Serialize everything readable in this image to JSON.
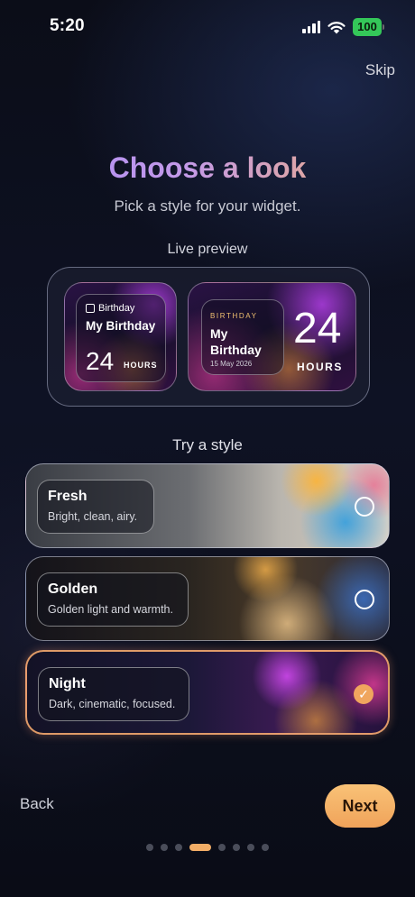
{
  "status": {
    "time": "5:20",
    "battery": "100"
  },
  "header": {
    "skip": "Skip",
    "title": "Choose a look",
    "subtitle": "Pick a style for your widget."
  },
  "preview": {
    "label": "Live preview",
    "small": {
      "tag": "Birthday",
      "name": "My Birthday",
      "number": "24",
      "unit": "HOURS"
    },
    "medium": {
      "tag": "BIRTHDAY",
      "name": "My Birthday",
      "date": "15 May 2026",
      "number": "24",
      "unit": "HOURS"
    }
  },
  "styles": {
    "label": "Try a style",
    "items": [
      {
        "title": "Fresh",
        "desc": "Bright, clean, airy.",
        "selected": false
      },
      {
        "title": "Golden",
        "desc": "Golden light and warmth.",
        "selected": false
      },
      {
        "title": "Night",
        "desc": "Dark, cinematic, focused.",
        "selected": true
      }
    ]
  },
  "footer": {
    "back": "Back",
    "next": "Next",
    "page_count": 8,
    "active_page": 4
  },
  "colors": {
    "accent": "#f0a65e",
    "title_start": "#a78bfa",
    "title_end": "#f4b06c"
  }
}
